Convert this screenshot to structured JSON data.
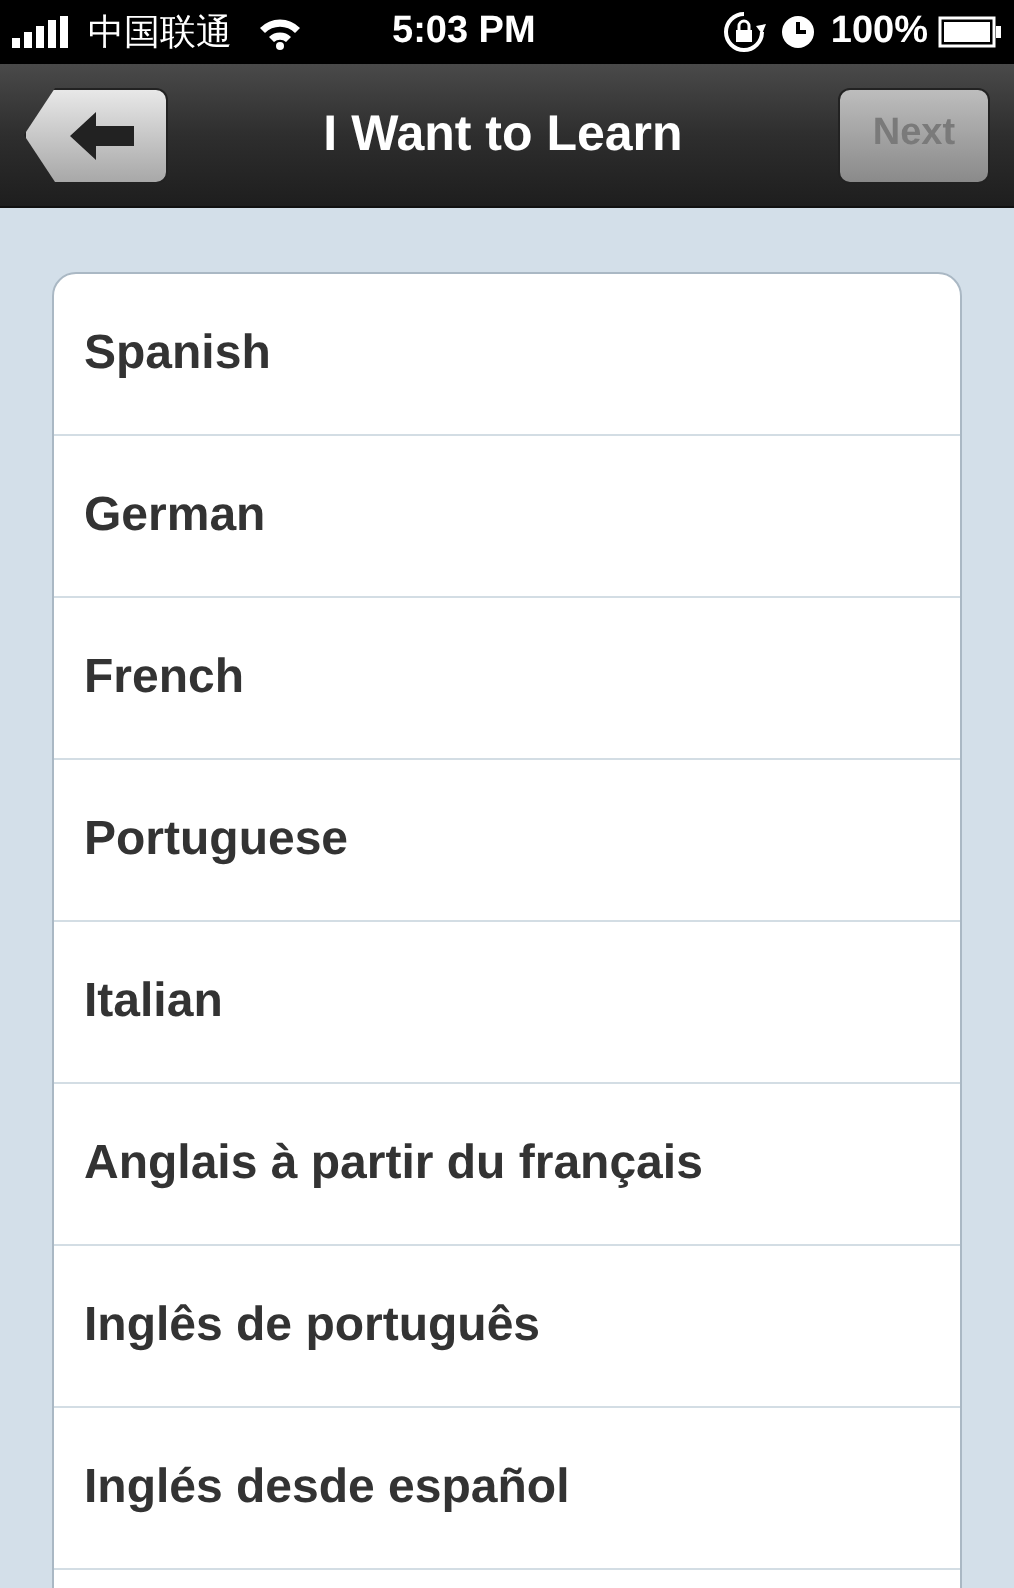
{
  "status_bar": {
    "carrier": "中国联通",
    "time": "5:03 PM",
    "battery": "100%"
  },
  "nav_bar": {
    "title": "I Want to Learn",
    "next_button": {
      "label": "Next",
      "disabled": true
    }
  },
  "languages": [
    {
      "label": "Spanish"
    },
    {
      "label": "German"
    },
    {
      "label": "French"
    },
    {
      "label": "Portuguese"
    },
    {
      "label": "Italian"
    },
    {
      "label": "Anglais à partir du français"
    },
    {
      "label": "Inglês de português"
    },
    {
      "label": "Inglés desde español"
    }
  ]
}
